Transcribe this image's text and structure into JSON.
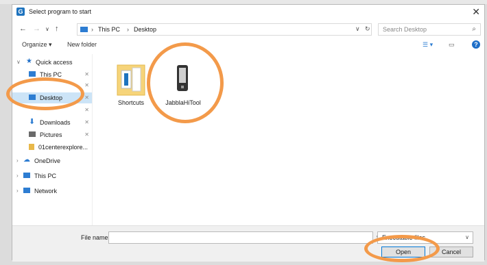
{
  "window": {
    "title": "Select program to start",
    "app_icon": "G"
  },
  "address": {
    "crumbs": [
      "This PC",
      "Desktop"
    ],
    "search_placeholder": "Search Desktop"
  },
  "toolbar": {
    "organize": "Organize ▾",
    "new_folder": "New folder"
  },
  "sidebar": {
    "items": [
      {
        "label": "Quick access",
        "icon": "star-icon",
        "color": "#1f6fc8"
      },
      {
        "label": "This PC",
        "icon": "pc-icon",
        "color": "#2d7dd2"
      },
      {
        "label": "",
        "icon": "",
        "color": ""
      },
      {
        "label": "Desktop",
        "icon": "desktop-icon",
        "color": "#2d7dd2"
      },
      {
        "label": "",
        "icon": "",
        "color": ""
      },
      {
        "label": "Downloads",
        "icon": "download-icon",
        "color": "#2d7dd2"
      },
      {
        "label": "Pictures",
        "icon": "pictures-icon",
        "color": "#6a6a6a"
      },
      {
        "label": "01centerexplore...",
        "icon": "folder-icon",
        "color": "#e8b84a"
      },
      {
        "label": "OneDrive",
        "icon": "cloud-icon",
        "color": "#2d7dd2"
      },
      {
        "label": "This PC",
        "icon": "pc-icon",
        "color": "#2d7dd2"
      },
      {
        "label": "Network",
        "icon": "network-icon",
        "color": "#2d7dd2"
      }
    ]
  },
  "files": [
    {
      "name": "Shortcuts",
      "icon": "folder-icon"
    },
    {
      "name": "JabblaHiTool",
      "icon": "app-icon"
    }
  ],
  "bottom": {
    "file_name_label": "File name:",
    "file_name_value": "",
    "filter_value": "Executable files",
    "open": "Open",
    "cancel": "Cancel"
  },
  "colors": {
    "highlight_ring": "#f39a4a",
    "selected_bg": "#cce4f7",
    "accent": "#0078d7"
  }
}
